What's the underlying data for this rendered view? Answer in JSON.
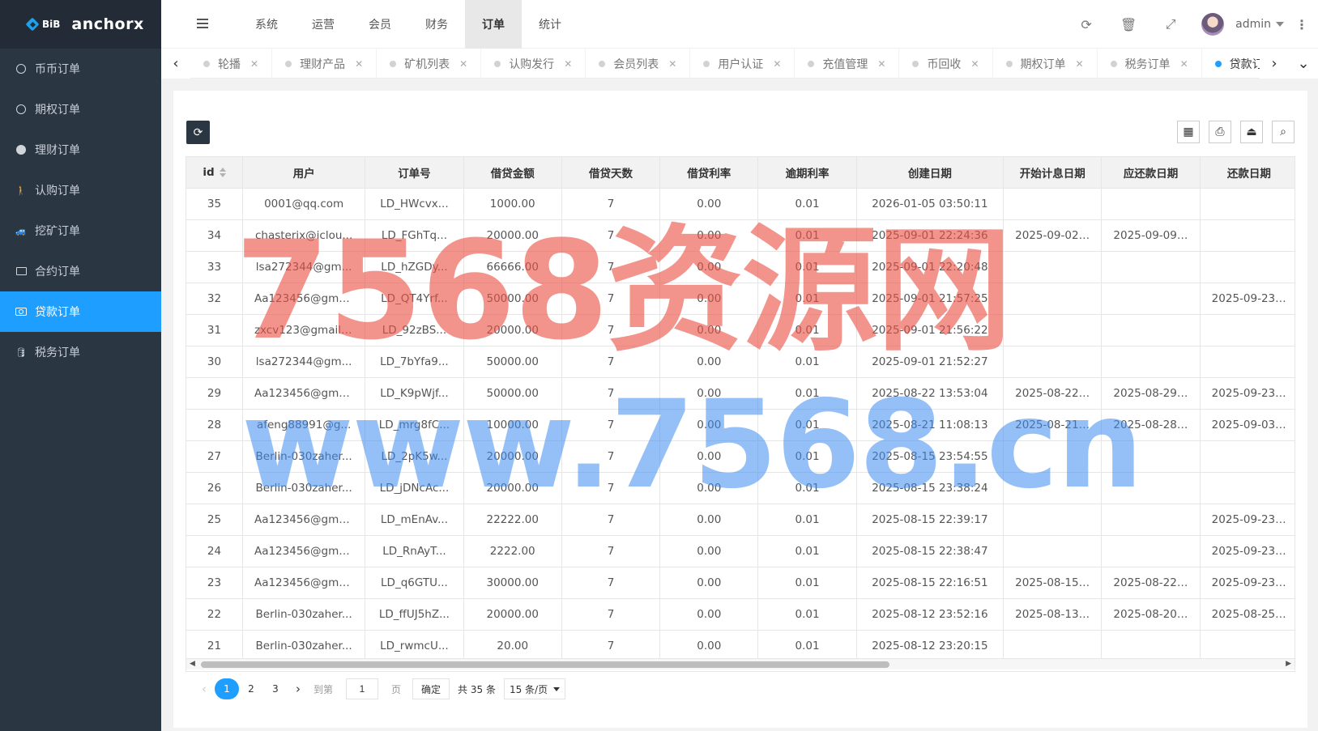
{
  "brand": {
    "logo_text": "BiB",
    "app_name": "anchorx"
  },
  "sidebar": {
    "items": [
      {
        "label": "币币订单",
        "icon": "cc-icon",
        "active": false
      },
      {
        "label": "期权订单",
        "icon": "clock-icon",
        "active": false
      },
      {
        "label": "理财订单",
        "icon": "coin-icon",
        "active": false
      },
      {
        "label": "认购订单",
        "icon": "walk-icon",
        "active": false
      },
      {
        "label": "挖矿订单",
        "icon": "car-icon",
        "active": false
      },
      {
        "label": "合约订单",
        "icon": "monitor-icon",
        "active": false
      },
      {
        "label": "贷款订单",
        "icon": "cash-icon",
        "active": true
      },
      {
        "label": "税务订单",
        "icon": "database-icon",
        "active": false
      }
    ]
  },
  "header": {
    "nav": [
      "系统",
      "运营",
      "会员",
      "财务",
      "订单",
      "统计"
    ],
    "active_nav": "订单",
    "user": "admin"
  },
  "tabs": [
    "轮播",
    "理财产品",
    "矿机列表",
    "认购发行",
    "会员列表",
    "用户认证",
    "充值管理",
    "币回收",
    "期权订单",
    "税务订单",
    "贷款订单"
  ],
  "active_tab": "贷款订单",
  "table": {
    "columns": [
      "id",
      "用户",
      "订单号",
      "借贷金额",
      "借贷天数",
      "借贷利率",
      "逾期利率",
      "创建日期",
      "开始计息日期",
      "应还款日期",
      "还款日期"
    ],
    "rows": [
      [
        "35",
        "0001@qq.com",
        "LD_HWcvx...",
        "1000.00",
        "7",
        "0.00",
        "0.01",
        "2026-01-05 03:50:11",
        "",
        "",
        ""
      ],
      [
        "34",
        "chasterix@iclou...",
        "LD_FGhTq...",
        "20000.00",
        "7",
        "0.00",
        "0.01",
        "2025-09-01 22:24:36",
        "2025-09-02 ...",
        "2025-09-09 ...",
        ""
      ],
      [
        "33",
        "lsa272344@gm...",
        "LD_hZGDy...",
        "66666.00",
        "7",
        "0.00",
        "0.01",
        "2025-09-01 22:20:48",
        "",
        "",
        ""
      ],
      [
        "32",
        "Aa123456@gma...",
        "LD_QT4Yrf...",
        "50000.00",
        "7",
        "0.00",
        "0.01",
        "2025-09-01 21:57:25",
        "",
        "",
        "2025-09-23 ..."
      ],
      [
        "31",
        "zxcv123@gmail....",
        "LD_92zBS...",
        "20000.00",
        "7",
        "0.00",
        "0.01",
        "2025-09-01 21:56:22",
        "",
        "",
        ""
      ],
      [
        "30",
        "lsa272344@gm...",
        "LD_7bYfa9...",
        "50000.00",
        "7",
        "0.00",
        "0.01",
        "2025-09-01 21:52:27",
        "",
        "",
        ""
      ],
      [
        "29",
        "Aa123456@gma...",
        "LD_K9pWjf...",
        "50000.00",
        "7",
        "0.00",
        "0.01",
        "2025-08-22 13:53:04",
        "2025-08-22 ...",
        "2025-08-29 ...",
        "2025-09-23 ..."
      ],
      [
        "28",
        "afeng88991@g...",
        "LD_mrg8fC...",
        "10000.00",
        "7",
        "0.00",
        "0.01",
        "2025-08-21 11:08:13",
        "2025-08-21 ...",
        "2025-08-28 ...",
        "2025-09-03 ..."
      ],
      [
        "27",
        "Berlin-030zaher...",
        "LD_2pK5w...",
        "20000.00",
        "7",
        "0.00",
        "0.01",
        "2025-08-15 23:54:55",
        "",
        "",
        ""
      ],
      [
        "26",
        "Berlin-030zaher...",
        "LD_jDNcAc...",
        "20000.00",
        "7",
        "0.00",
        "0.01",
        "2025-08-15 23:38:24",
        "",
        "",
        ""
      ],
      [
        "25",
        "Aa123456@gma...",
        "LD_mEnAv...",
        "22222.00",
        "7",
        "0.00",
        "0.01",
        "2025-08-15 22:39:17",
        "",
        "",
        "2025-09-23 ..."
      ],
      [
        "24",
        "Aa123456@gma...",
        "LD_RnAyT...",
        "2222.00",
        "7",
        "0.00",
        "0.01",
        "2025-08-15 22:38:47",
        "",
        "",
        "2025-09-23 ..."
      ],
      [
        "23",
        "Aa123456@gma...",
        "LD_q6GTU...",
        "30000.00",
        "7",
        "0.00",
        "0.01",
        "2025-08-15 22:16:51",
        "2025-08-15 ...",
        "2025-08-22 ...",
        "2025-09-23 ..."
      ],
      [
        "22",
        "Berlin-030zaher...",
        "LD_ffUJ5hZ...",
        "20000.00",
        "7",
        "0.00",
        "0.01",
        "2025-08-12 23:52:16",
        "2025-08-13 ...",
        "2025-08-20 ...",
        "2025-08-25 ..."
      ],
      [
        "21",
        "Berlin-030zaher...",
        "LD_rwmcU...",
        "20.00",
        "7",
        "0.00",
        "0.01",
        "2025-08-12 23:20:15",
        "",
        "",
        ""
      ]
    ]
  },
  "pager": {
    "pages": [
      "1",
      "2",
      "3"
    ],
    "current": "1",
    "goto_label": "到第",
    "goto_value": "1",
    "page_unit": "页",
    "confirm": "确定",
    "total": "共 35 条",
    "per_page": "15 条/页"
  },
  "watermark": {
    "line1": "7568资源网",
    "line2": "www.7568.cn"
  },
  "colors": {
    "sidebar_bg": "#2b3643",
    "accent": "#1e9fff"
  }
}
